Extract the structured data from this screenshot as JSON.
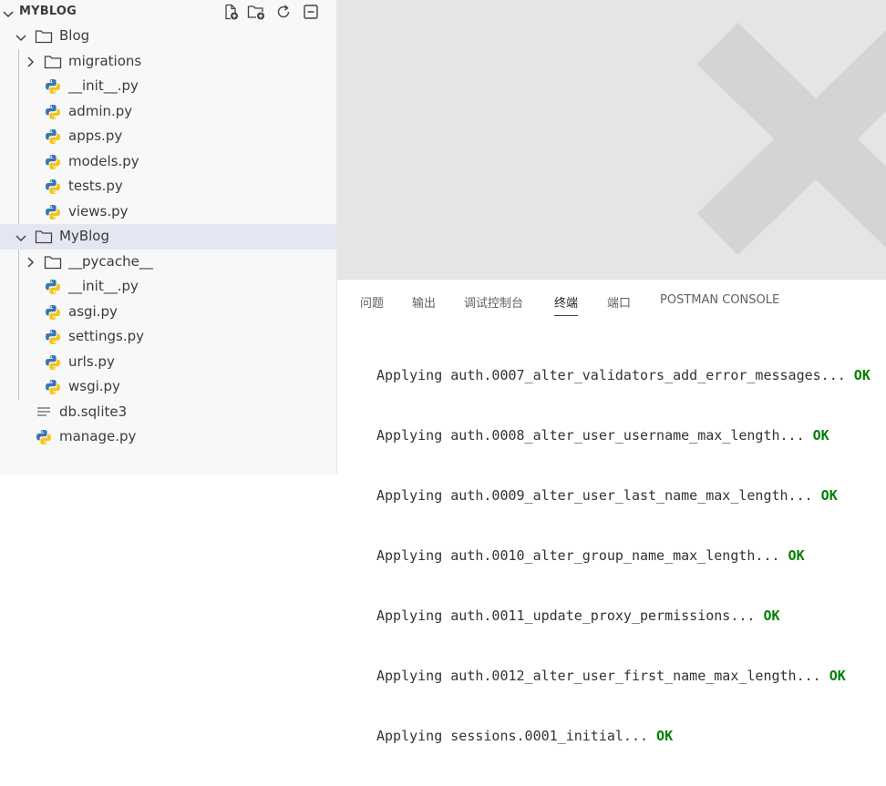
{
  "explorer": {
    "title": "MYBLOG",
    "actions": [
      "new-file",
      "new-folder",
      "refresh",
      "collapse-all"
    ],
    "tree": [
      {
        "label": "Blog",
        "kind": "folder",
        "expanded": true
      },
      {
        "label": "migrations",
        "kind": "folder",
        "expanded": false
      },
      {
        "label": "__init__.py",
        "kind": "python"
      },
      {
        "label": "admin.py",
        "kind": "python"
      },
      {
        "label": "apps.py",
        "kind": "python"
      },
      {
        "label": "models.py",
        "kind": "python"
      },
      {
        "label": "tests.py",
        "kind": "python"
      },
      {
        "label": "views.py",
        "kind": "python"
      },
      {
        "label": "MyBlog",
        "kind": "folder",
        "expanded": true,
        "selected": true
      },
      {
        "label": "__pycache__",
        "kind": "folder",
        "expanded": false
      },
      {
        "label": "__init__.py",
        "kind": "python"
      },
      {
        "label": "asgi.py",
        "kind": "python"
      },
      {
        "label": "settings.py",
        "kind": "python"
      },
      {
        "label": "urls.py",
        "kind": "python"
      },
      {
        "label": "wsgi.py",
        "kind": "python"
      },
      {
        "label": "db.sqlite3",
        "kind": "text"
      },
      {
        "label": "manage.py",
        "kind": "python"
      }
    ]
  },
  "panel": {
    "tabs": [
      "问题",
      "输出",
      "调试控制台",
      "终端",
      "端口",
      "POSTMAN CONSOLE"
    ],
    "active_tab": "终端",
    "terminal_lines": [
      {
        "text": "Applying auth.0007_alter_validators_add_error_messages...",
        "status": "OK"
      },
      {
        "text": "Applying auth.0008_alter_user_username_max_length...",
        "status": "OK"
      },
      {
        "text": "Applying auth.0009_alter_user_last_name_max_length...",
        "status": "OK"
      },
      {
        "text": "Applying auth.0010_alter_group_name_max_length...",
        "status": "OK"
      },
      {
        "text": "Applying auth.0011_update_proxy_permissions...",
        "status": "OK"
      },
      {
        "text": "Applying auth.0012_alter_user_first_name_max_length...",
        "status": "OK"
      },
      {
        "text": "Applying sessions.0001_initial...",
        "status": "OK"
      }
    ]
  },
  "colors": {
    "ok": "#008000",
    "python_blue": "#3a76b0",
    "python_yellow": "#f5c518",
    "selected_row": "#e4e6f1",
    "editor_bg": "#e5e5e5",
    "watermark": "#d4d4d4"
  }
}
